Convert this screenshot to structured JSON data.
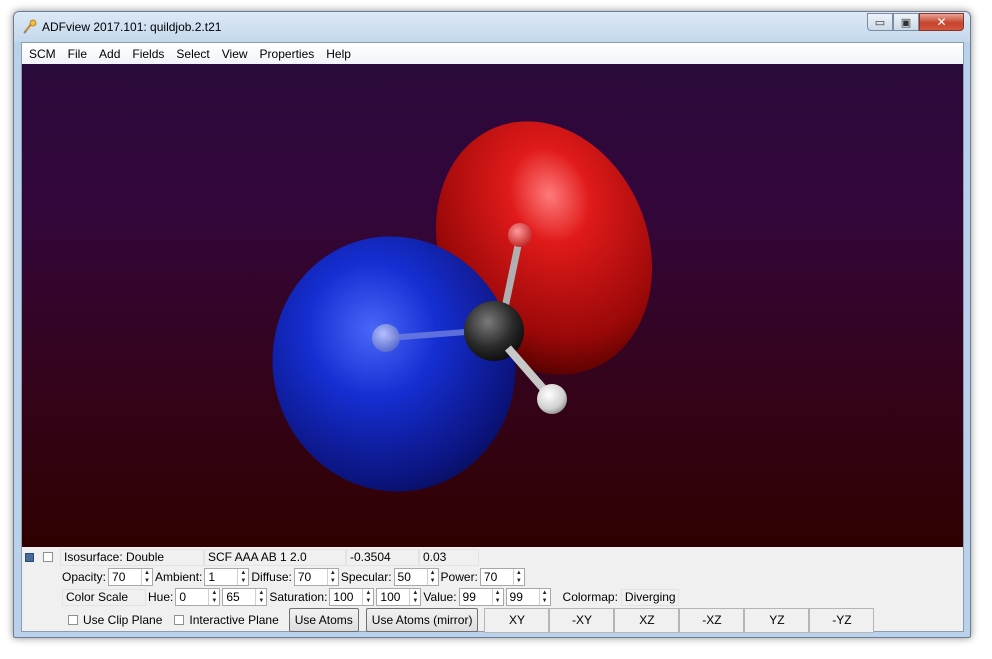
{
  "window": {
    "title": "ADFview 2017.101: quildjob.2.t21",
    "minimize_glyph": "▭",
    "maximize_glyph": "▣",
    "close_glyph": "✕"
  },
  "menu": [
    "SCM",
    "File",
    "Add",
    "Fields",
    "Select",
    "View",
    "Properties",
    "Help"
  ],
  "colors": {
    "lobe_positive": "#d01010",
    "lobe_negative": "#1a2fd0",
    "carbon": "#2a2a2a",
    "hydrogen": "#e8e8e8",
    "oxygen": "#e04040"
  },
  "isosurface": {
    "type_label": "Isosurface: Double",
    "field_name": "SCF AAA AB 1 2.0",
    "field_value": "-0.3504",
    "iso_value": "0.03"
  },
  "lighting": {
    "opacity_label": "Opacity:",
    "opacity": "70",
    "ambient_label": "Ambient:",
    "ambient": "1",
    "diffuse_label": "Diffuse:",
    "diffuse": "70",
    "specular_label": "Specular:",
    "specular": "50",
    "power_label": "Power:",
    "power": "70"
  },
  "color": {
    "mode": "Color Scale",
    "hue_label": "Hue:",
    "hue_min": "0",
    "hue_max": "65",
    "saturation_label": "Saturation:",
    "saturation_min": "100",
    "saturation_max": "100",
    "value_label": "Value:",
    "value_min": "99",
    "value_max": "99",
    "colormap_label": "Colormap:",
    "colormap": "Diverging"
  },
  "options": {
    "clip_plane": "Use Clip Plane",
    "interactive_plane": "Interactive Plane",
    "use_atoms": "Use Atoms",
    "use_atoms_mirror": "Use Atoms (mirror)"
  },
  "view_buttons": [
    "XY",
    "-XY",
    "XZ",
    "-XZ",
    "YZ",
    "-YZ"
  ]
}
